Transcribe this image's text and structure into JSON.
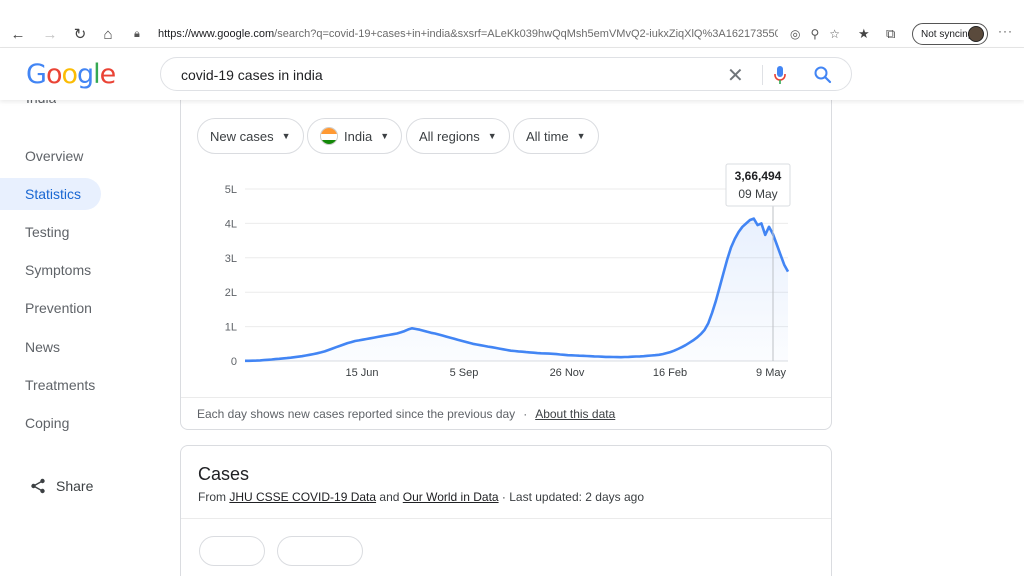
{
  "browser": {
    "url_host": "https://www.google.com",
    "url_rest": "/search?q=covid-19+cases+in+india&sxsrf=ALeKk039hwQqMsh5emVMvQ2-iukxZiqXlQ%3A162173550...",
    "sync_label": "Not syncing",
    "more_label": "···"
  },
  "search": {
    "query": "covid-19 cases in india"
  },
  "sidebar": {
    "partial_label": "India",
    "items": [
      {
        "label": "Overview"
      },
      {
        "label": "Statistics",
        "active": true
      },
      {
        "label": "Testing"
      },
      {
        "label": "Symptoms"
      },
      {
        "label": "Prevention"
      },
      {
        "label": "News"
      },
      {
        "label": "Treatments"
      },
      {
        "label": "Coping"
      }
    ],
    "share_label": "Share"
  },
  "filters": {
    "metric": "New cases",
    "country": "India",
    "regions": "All regions",
    "time": "All time"
  },
  "chart_data": {
    "type": "line",
    "ylim": [
      0,
      500000
    ],
    "y_ticks": [
      0,
      100000,
      200000,
      300000,
      400000,
      500000
    ],
    "y_tick_labels": [
      "0",
      "1L",
      "2L",
      "3L",
      "4L",
      "5L"
    ],
    "x_tick_labels": [
      "15 Jun",
      "5 Sep",
      "26 Nov",
      "16 Feb",
      "9 May"
    ],
    "series": [
      {
        "values": [
          500,
          600,
          800,
          1200,
          1800,
          2500,
          3500,
          4500,
          5500,
          6500,
          7500,
          8500,
          9500,
          11000,
          12500,
          14000,
          16000,
          18000,
          20000,
          22500,
          25000,
          28000,
          32000,
          36000,
          40000,
          44000,
          48000,
          52000,
          55000,
          58000,
          60000,
          62000,
          64000,
          66000,
          68000,
          70000,
          72000,
          74000,
          76000,
          78000,
          80000,
          83000,
          87000,
          92000,
          95000,
          93000,
          91000,
          88000,
          85000,
          82000,
          80000,
          77000,
          74000,
          71000,
          68000,
          65000,
          62000,
          59000,
          56000,
          53000,
          50000,
          48000,
          46000,
          44000,
          42000,
          40000,
          38000,
          36000,
          34000,
          32000,
          30000,
          29000,
          28000,
          27000,
          26000,
          25000,
          24000,
          23000,
          22500,
          22000,
          21500,
          21000,
          20000,
          19000,
          18000,
          17000,
          16500,
          16000,
          15500,
          15000,
          14500,
          14000,
          13500,
          13000,
          12500,
          12000,
          11800,
          11500,
          11200,
          11000,
          11500,
          12000,
          12500,
          13000,
          13500,
          14000,
          15000,
          16000,
          17000,
          18000,
          20000,
          23000,
          26000,
          30000,
          35000,
          40000,
          46000,
          53000,
          60000,
          68000,
          78000,
          90000,
          110000,
          140000,
          175000,
          215000,
          255000,
          295000,
          330000,
          355000,
          375000,
          390000,
          400000,
          410000,
          414000,
          395000,
          400000,
          366494,
          390000,
          370000,
          340000,
          310000,
          280000,
          260000
        ]
      }
    ],
    "tooltip": {
      "value": "3,66,494",
      "date": "09 May"
    }
  },
  "footer": {
    "note": "Each day shows new cases reported since the previous day",
    "dot": "·",
    "link": "About this data"
  },
  "cases": {
    "title": "Cases",
    "from": "From ",
    "source1": "JHU CSSE COVID-19 Data",
    "and": " and ",
    "source2": "Our World in Data",
    "updated": " · Last updated: 2 days ago"
  }
}
